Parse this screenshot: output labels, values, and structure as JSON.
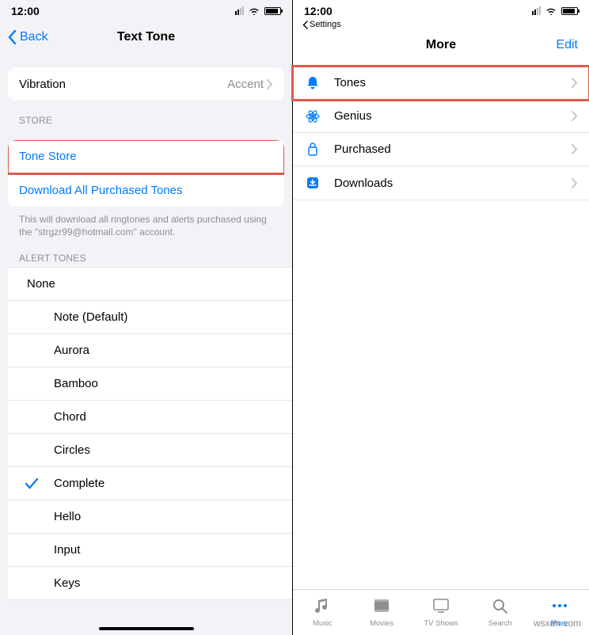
{
  "status": {
    "time": "12:00"
  },
  "left": {
    "nav_back": "Back",
    "title": "Text Tone",
    "vibration": {
      "label": "Vibration",
      "value": "Accent"
    },
    "store_header": "STORE",
    "tone_store": "Tone Store",
    "download_all": "Download All Purchased Tones",
    "footer": "This will download all ringtones and alerts purchased using the \"strgzr99@hotmail.com\" account.",
    "alert_header": "ALERT TONES",
    "tones": [
      "None",
      "Note (Default)",
      "Aurora",
      "Bamboo",
      "Chord",
      "Circles",
      "Complete",
      "Hello",
      "Input",
      "Keys"
    ],
    "selected_index": 6
  },
  "right": {
    "breadcrumb": "Settings",
    "title": "More",
    "edit": "Edit",
    "items": [
      {
        "icon": "bell",
        "label": "Tones",
        "hl": true
      },
      {
        "icon": "atom",
        "label": "Genius",
        "hl": false
      },
      {
        "icon": "bag",
        "label": "Purchased",
        "hl": false
      },
      {
        "icon": "download",
        "label": "Downloads",
        "hl": false
      }
    ],
    "tabs": [
      {
        "label": "Music",
        "icon": "music"
      },
      {
        "label": "Movies",
        "icon": "movies"
      },
      {
        "label": "TV Shows",
        "icon": "tv"
      },
      {
        "label": "Search",
        "icon": "search"
      },
      {
        "label": "More",
        "icon": "more"
      }
    ],
    "active_tab": 4
  },
  "watermark": "wsxdn.com"
}
